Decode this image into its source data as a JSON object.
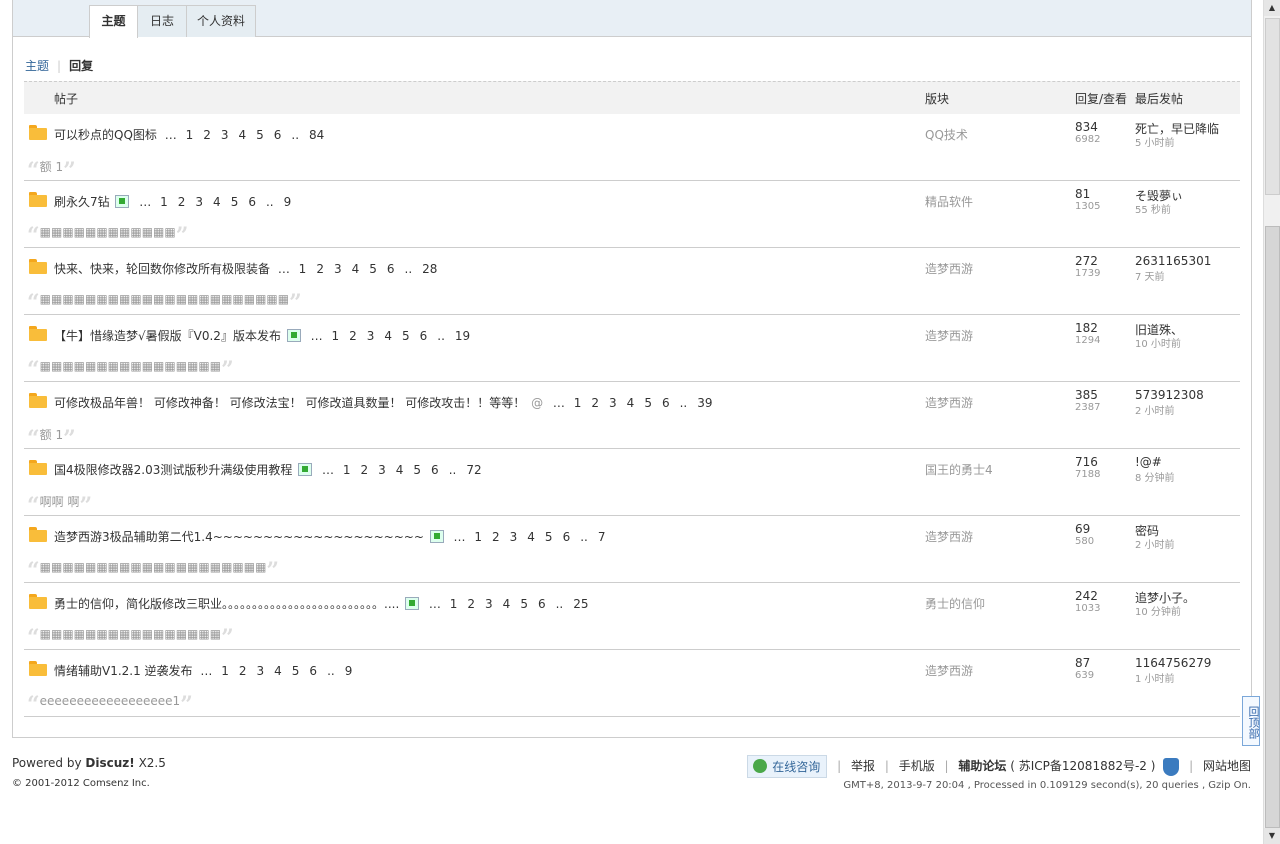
{
  "tabs": [
    {
      "label": "主题",
      "active": true
    },
    {
      "label": "日志",
      "active": false
    },
    {
      "label": "个人资料",
      "active": false
    }
  ],
  "subnav": {
    "topics": "主题",
    "replies": "回复"
  },
  "table_header": {
    "post": "帖子",
    "forum": "版块",
    "reply_view": "回复/查看",
    "last_post": "最后发帖"
  },
  "rows": [
    {
      "title": "可以秒点的QQ图标",
      "img": false,
      "clip": false,
      "pages": [
        "1",
        "2",
        "3",
        "4",
        "5",
        "6",
        "..",
        "84"
      ],
      "forum": "QQ技术",
      "replies": "834",
      "views": "6982",
      "last_user": "死亡，早已降临",
      "last_time": "5 小时前",
      "quote": "额 1"
    },
    {
      "title": "刷永久7钻",
      "img": true,
      "clip": false,
      "pages": [
        "1",
        "2",
        "3",
        "4",
        "5",
        "6",
        "..",
        "9"
      ],
      "forum": "精品软件",
      "replies": "81",
      "views": "1305",
      "last_user": "そ毁夢ぃ",
      "last_time": "55 秒前",
      "quote": "▦▦▦▦▦▦▦▦▦▦▦▦"
    },
    {
      "title": "快来、快来，轮回数你修改所有极限装备",
      "img": false,
      "clip": false,
      "pages": [
        "1",
        "2",
        "3",
        "4",
        "5",
        "6",
        "..",
        "28"
      ],
      "forum": "造梦西游",
      "replies": "272",
      "views": "1739",
      "last_user": "2631165301",
      "last_time": "7 天前",
      "quote": "▦▦▦▦▦▦▦▦▦▦▦▦▦▦▦▦▦▦▦▦▦▦"
    },
    {
      "title": "【牛】惜缘造梦√暑假版『V0.2』版本发布",
      "img": true,
      "clip": false,
      "pages": [
        "1",
        "2",
        "3",
        "4",
        "5",
        "6",
        "..",
        "19"
      ],
      "forum": "造梦西游",
      "replies": "182",
      "views": "1294",
      "last_user": "旧道殊、",
      "last_time": "10 小时前",
      "quote": "▦▦▦▦▦▦▦▦▦▦▦▦▦▦▦▦"
    },
    {
      "title": "可修改极品年兽！ 可修改神备！ 可修改法宝！ 可修改道具数量！ 可修改攻击！！等等！",
      "img": false,
      "clip": true,
      "pages": [
        "1",
        "2",
        "3",
        "4",
        "5",
        "6",
        "..",
        "39"
      ],
      "forum": "造梦西游",
      "replies": "385",
      "views": "2387",
      "last_user": "573912308",
      "last_time": "2 小时前",
      "quote": "额 1"
    },
    {
      "title": "国4极限修改器2.03测试版秒升满级使用教程",
      "img": true,
      "clip": false,
      "pages": [
        "1",
        "2",
        "3",
        "4",
        "5",
        "6",
        "..",
        "72"
      ],
      "forum": "国王的勇士4",
      "replies": "716",
      "views": "7188",
      "last_user": "!@#",
      "last_time": "8 分钟前",
      "quote": "啊啊 啊"
    },
    {
      "title": "造梦西游3极品辅助第二代1.4~~~~~~~~~~~~~~~~~~~~~",
      "img": true,
      "clip": false,
      "pages": [
        "1",
        "2",
        "3",
        "4",
        "5",
        "6",
        "..",
        "7"
      ],
      "forum": "造梦西游",
      "replies": "69",
      "views": "580",
      "last_user": "密码",
      "last_time": "2 小时前",
      "quote": "▦▦▦▦▦▦▦▦▦▦▦▦▦▦▦▦▦▦▦▦"
    },
    {
      "title": "勇士的信仰，简化版修改三职业。。。。。。。。。。。。。。。。。。。。。。。。。。....",
      "img": true,
      "clip": false,
      "pages": [
        "1",
        "2",
        "3",
        "4",
        "5",
        "6",
        "..",
        "25"
      ],
      "forum": "勇士的信仰",
      "replies": "242",
      "views": "1033",
      "last_user": "追梦小子。",
      "last_time": "10 分钟前",
      "quote": "▦▦▦▦▦▦▦▦▦▦▦▦▦▦▦▦"
    },
    {
      "title": "情绪辅助V1.2.1 逆袭发布",
      "img": false,
      "clip": false,
      "pages": [
        "1",
        "2",
        "3",
        "4",
        "5",
        "6",
        "..",
        "9"
      ],
      "forum": "造梦西游",
      "replies": "87",
      "views": "639",
      "last_user": "1164756279",
      "last_time": "1 小时前",
      "quote": "eeeeeeeeeeeeeeeeee1"
    }
  ],
  "footer": {
    "powered_by": "Powered by",
    "discuz": "Discuz!",
    "version": "X2.5",
    "copyright": "© 2001-2012 Comsenz Inc.",
    "consult": "在线咨询",
    "report": "举报",
    "mobile": "手机版",
    "site_name": "辅助论坛",
    "icp": "( 苏ICP备12081882号-2 )",
    "sitemap": "网站地图",
    "gmt": "GMT+8, 2013-9-7 20:04 , Processed in 0.109129 second(s), 20 queries , Gzip On."
  },
  "back_top": "回顶部",
  "colors": {
    "link": "#336699",
    "border": "#cdcdcd",
    "folder": "#f9bd3a"
  }
}
